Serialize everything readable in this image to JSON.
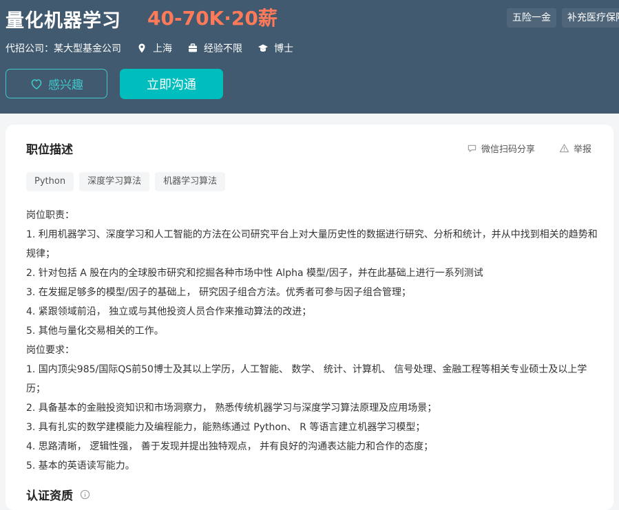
{
  "job": {
    "title": "量化机器学习",
    "salary": "40-70K·20薪",
    "benefits": [
      "五险一金",
      "补充医疗保险"
    ],
    "company_label": "代招公司：某大型基金公司",
    "location": "上海",
    "experience": "经验不限",
    "degree": "博士"
  },
  "actions": {
    "interest_label": "感兴趣",
    "chat_label": "立即沟通"
  },
  "section": {
    "title": "职位描述",
    "share_label": "微信扫码分享",
    "report_label": "举报",
    "skills": [
      "Python",
      "深度学习算法",
      "机器学习算法"
    ],
    "description_lines": [
      "岗位职责：",
      "1. 利用机器学习、深度学习和人工智能的方法在公司研究平台上对大量历史性的数据进行研究、分析和统计，并从中找到相关的趋势和规律；",
      "2. 针对包括 A 股在内的全球股市研究和挖掘各种市场中性 Alpha 模型/因子，并在此基础上进行一系列测试",
      "3. 在发掘足够多的模型/因子的基础上， 研究因子组合方法。优秀者可参与因子组合管理；",
      "4. 紧跟领域前沿， 独立或与其他投资人员合作来推动算法的改进；",
      "5. 其他与量化交易相关的工作。",
      "岗位要求：",
      "1. 国内顶尖985/国际QS前50博士及其以上学历，人工智能、 数学、 统计、计算机、 信号处理、金融工程等相关专业硕士及以上学历；",
      "2. 具备基本的金融投资知识和市场洞察力， 熟悉传统机器学习与深度学习算法原理及应用场景；",
      "3. 具有扎实的数学建模能力及编程能力，能熟练通过 Python、 R 等语言建立机器学习模型；",
      "4. 思路清晰， 逻辑性强， 善于发现并提出独特观点， 并有良好的沟通表达能力和合作的态度；",
      "5. 基本的英语读写能力。"
    ],
    "cert_title": "认证资质"
  },
  "colors": {
    "header_bg": "#415a6f",
    "accent": "#00bebd",
    "salary": "#ff7a59"
  }
}
